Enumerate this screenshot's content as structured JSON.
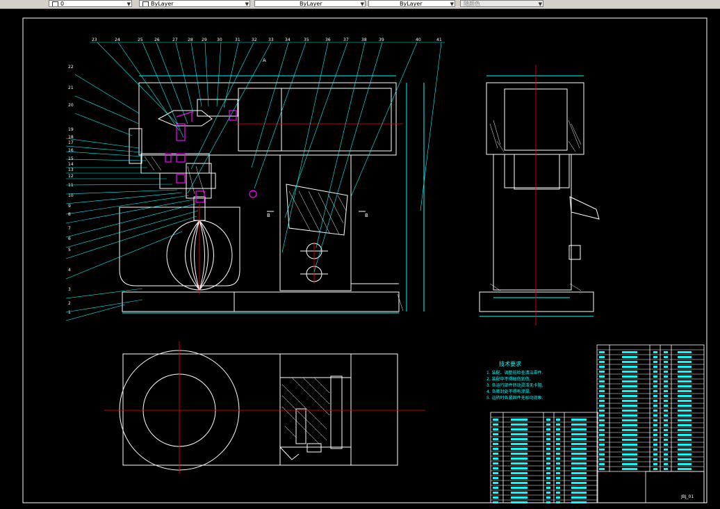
{
  "toolbar": {
    "layer_combo": "0",
    "color_combo": "ByLayer",
    "linetype_combo": "ByLayer",
    "lineweight_combo": "ByLayer",
    "plotstyle_combo": "随颜色"
  },
  "drawing": {
    "tech_req_title": "技术要求",
    "tech_req_lines": [
      "1. 装配、调整前检查清洁零件.",
      "2. 装配中不得碰伤划伤.",
      "3. 各运行部件转动灵活无卡阻.",
      "4. 各密封处不得有渗漏.",
      "5. 运转时各紧固件无松动现象."
    ],
    "drawing_number": "JBJ_01",
    "balloons_top": [
      "23",
      "24",
      "25",
      "26",
      "27",
      "28",
      "29",
      "30",
      "31",
      "32",
      "33",
      "34",
      "35",
      "36",
      "37",
      "38",
      "39",
      "40",
      "41"
    ],
    "balloons_left": [
      "22",
      "21",
      "20",
      "19",
      "18",
      "17",
      "16",
      "15",
      "14",
      "13",
      "12",
      "11",
      "10",
      "9",
      "8",
      "7",
      "6",
      "5",
      "4",
      "3",
      "2",
      "1"
    ],
    "dim_labels": {
      "section_a": "A",
      "section_b": "B"
    }
  },
  "colors": {
    "background": "#000000",
    "outline": "#ffffff",
    "centerline": "#ff0000",
    "leader": "#00ffff",
    "part": "#ff00ff",
    "toolbar": "#d4d0c8"
  }
}
